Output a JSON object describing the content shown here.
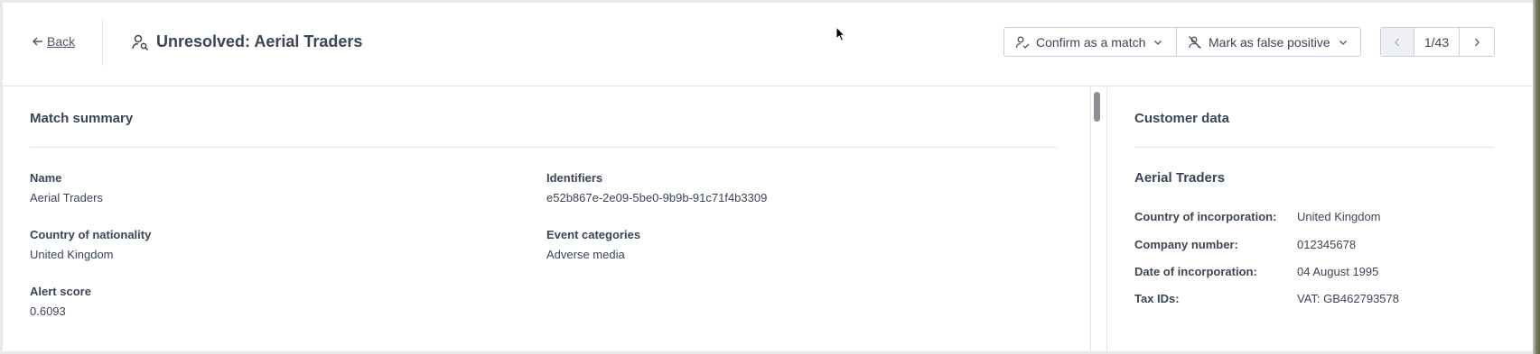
{
  "header": {
    "back_label": "Back",
    "title": "Unresolved: Aerial Traders",
    "confirm_label": "Confirm as a match",
    "false_positive_label": "Mark as false positive",
    "pager_text": "1/43"
  },
  "match_summary": {
    "title": "Match summary",
    "fields": {
      "name_label": "Name",
      "name_value": "Aerial Traders",
      "identifiers_label": "Identifiers",
      "identifiers_value": "e52b867e-2e09-5be0-9b9b-91c71f4b3309",
      "nationality_label": "Country of nationality",
      "nationality_value": "United Kingdom",
      "event_label": "Event categories",
      "event_value": "Adverse media",
      "alert_label": "Alert score",
      "alert_value": "0.6093"
    }
  },
  "customer_data": {
    "title": "Customer data",
    "entity_name": "Aerial Traders",
    "rows": [
      {
        "label": "Country of incorporation:",
        "value": "United Kingdom"
      },
      {
        "label": "Company number:",
        "value": "012345678"
      },
      {
        "label": "Date of incorporation:",
        "value": "04 August 1995"
      },
      {
        "label": "Tax IDs:",
        "value": "VAT: GB462793578"
      }
    ]
  }
}
